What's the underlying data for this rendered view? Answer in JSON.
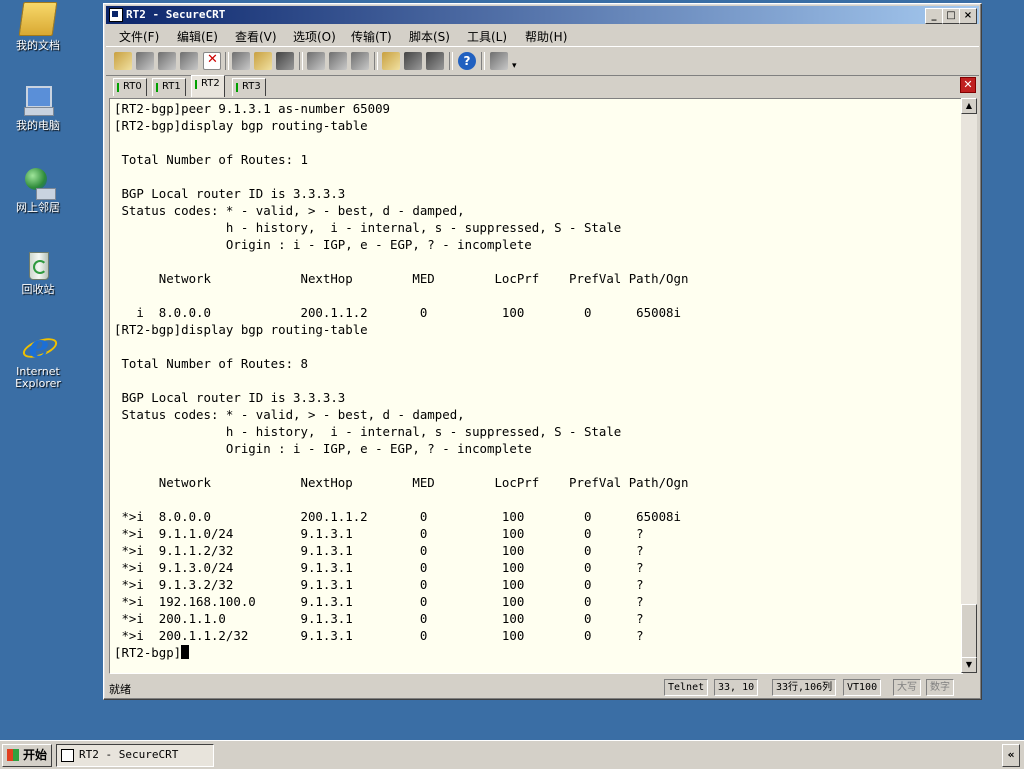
{
  "desktop": {
    "icons": [
      {
        "label": "我的文档",
        "icon": "my-documents-icon"
      },
      {
        "label": "我的电脑",
        "icon": "my-computer-icon"
      },
      {
        "label": "网上邻居",
        "icon": "network-places-icon"
      },
      {
        "label": "回收站",
        "icon": "recycle-bin-icon"
      },
      {
        "label": "Internet Explorer",
        "icon": "internet-explorer-icon"
      }
    ]
  },
  "window": {
    "title": "RT2 - SecureCRT",
    "controls": {
      "minimize": "_",
      "maximize": "□",
      "close": "×"
    }
  },
  "menu": [
    "文件(F)",
    "编辑(E)",
    "查看(V)",
    "选项(O)",
    "传输(T)",
    "脚本(S)",
    "工具(L)",
    "帮助(H)"
  ],
  "tabs": [
    {
      "label": "RT0",
      "active": false
    },
    {
      "label": "RT1",
      "active": false
    },
    {
      "label": "RT2",
      "active": true
    },
    {
      "label": "RT3",
      "active": false
    }
  ],
  "terminal": {
    "lines": [
      "[RT2-bgp]peer 9.1.3.1 as-number 65009",
      "[RT2-bgp]display bgp routing-table",
      "",
      " Total Number of Routes: 1",
      "",
      " BGP Local router ID is 3.3.3.3",
      " Status codes: * - valid, > - best, d - damped,",
      "               h - history,  i - internal, s - suppressed, S - Stale",
      "               Origin : i - IGP, e - EGP, ? - incomplete",
      "",
      "      Network            NextHop        MED        LocPrf    PrefVal Path/Ogn",
      "",
      "   i  8.0.0.0            200.1.1.2       0          100        0      65008i",
      "[RT2-bgp]display bgp routing-table",
      "",
      " Total Number of Routes: 8",
      "",
      " BGP Local router ID is 3.3.3.3",
      " Status codes: * - valid, > - best, d - damped,",
      "               h - history,  i - internal, s - suppressed, S - Stale",
      "               Origin : i - IGP, e - EGP, ? - incomplete",
      "",
      "      Network            NextHop        MED        LocPrf    PrefVal Path/Ogn",
      "",
      " *>i  8.0.0.0            200.1.1.2       0          100        0      65008i",
      " *>i  9.1.1.0/24         9.1.3.1         0          100        0      ?",
      " *>i  9.1.1.2/32         9.1.3.1         0          100        0      ?",
      " *>i  9.1.3.0/24         9.1.3.1         0          100        0      ?",
      " *>i  9.1.3.2/32         9.1.3.1         0          100        0      ?",
      " *>i  192.168.100.0      9.1.3.1         0          100        0      ?",
      " *>i  200.1.1.0          9.1.3.1         0          100        0      ?",
      " *>i  200.1.1.2/32       9.1.3.1         0          100        0      ?"
    ],
    "prompt": "[RT2-bgp]"
  },
  "status": {
    "ready": "就绪",
    "protocol": "Telnet",
    "cursor_pos": "33,  10",
    "size": "33行,106列",
    "emulation": "VT100",
    "caps": "大写",
    "num": "数字"
  },
  "taskbar": {
    "start": "开始",
    "task": "RT2 - SecureCRT",
    "tray": "«"
  }
}
